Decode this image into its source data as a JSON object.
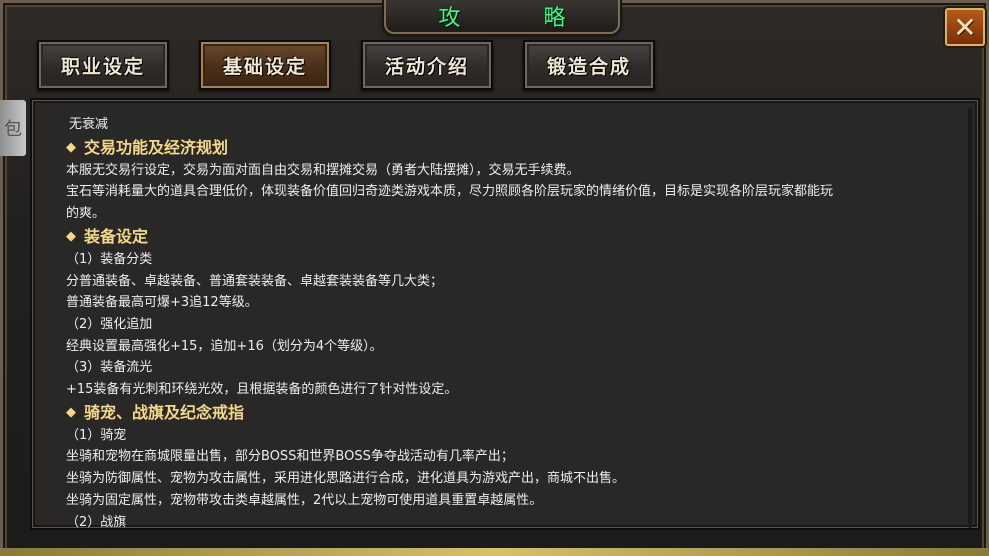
{
  "window": {
    "title": "攻 略",
    "close_glyph": "✕"
  },
  "tabs": [
    {
      "label": "职业设定",
      "active": false
    },
    {
      "label": "基础设定",
      "active": true
    },
    {
      "label": "活动介绍",
      "active": false
    },
    {
      "label": "锻造合成",
      "active": false
    }
  ],
  "side_tab": {
    "label": "包"
  },
  "content": {
    "intro_line": "无衰减",
    "sections": [
      {
        "heading": "交易功能及经济规划",
        "lines": [
          "本服无交易行设定，交易为面对面自由交易和摆摊交易（勇者大陆摆摊），交易无手续费。",
          "宝石等消耗量大的道具合理低价，体现装备价值回归奇迹类游戏本质，尽力照顾各阶层玩家的情绪价值，目标是实现各阶层玩家都能玩",
          "的爽。"
        ]
      },
      {
        "heading": "装备设定",
        "lines": [
          "（1）装备分类",
          "分普通装备、卓越装备、普通套装装备、卓越套装装备等几大类；",
          "普通装备最高可爆+3追12等级。",
          "（2）强化追加",
          "经典设置最高强化+15，追加+16（划分为4个等级）。",
          "（3）装备流光",
          "+15装备有光刺和环绕光效，且根据装备的颜色进行了针对性设定。"
        ]
      },
      {
        "heading": "骑宠、战旗及纪念戒指",
        "lines": [
          "（1）骑宠",
          "坐骑和宠物在商城限量出售，部分BOSS和世界BOSS争夺战活动有几率产出；",
          "坐骑为防御属性、宠物为攻击属性，采用进化思路进行合成，进化道具为游戏产出，商城不出售。",
          "坐骑为固定属性，宠物带攻击类卓越属性，2代以上宠物可使用道具重置卓越属性。",
          "（2）战旗"
        ]
      }
    ]
  },
  "colors": {
    "title_green": "#48f08a",
    "heading_gold": "#f2d88a",
    "body_text": "#ededed",
    "panel_bg": "#2a2827"
  },
  "icons": {
    "close": "close-icon",
    "heading_bullet": "diamond-bullet-icon"
  }
}
